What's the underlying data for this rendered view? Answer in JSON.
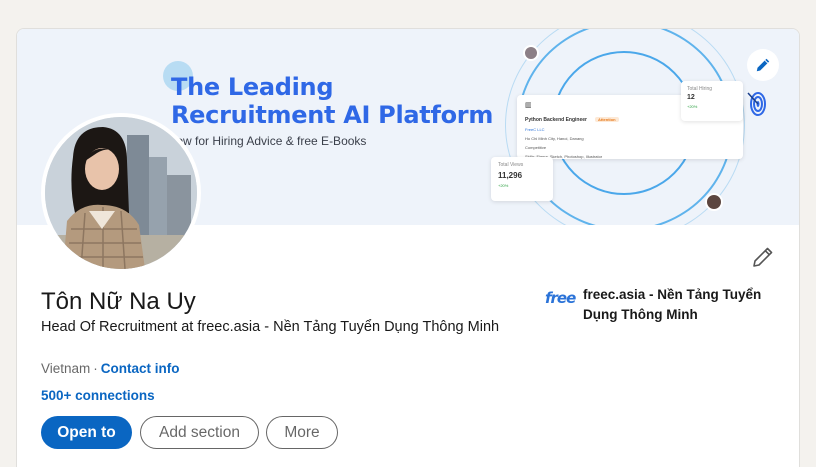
{
  "banner": {
    "headline_line1": "The Leading",
    "headline_line2": "Recruitment AI Platform",
    "subtitle": "llow for Hiring Advice & free E-Books",
    "job_card": {
      "title": "Python Backend Engineer",
      "tag": "Attention",
      "company": "FreeC LLC",
      "location": "Ho Chi Minh City, Hanoi, Danang",
      "salary": "Competitive",
      "skills": "Skills: Figma, Sketch, Photoshop, Illustrator"
    },
    "hiring_card": {
      "label": "Total Hiring",
      "value": "12",
      "change": "+20%"
    },
    "views_card": {
      "label": "Total Views",
      "value": "11,296",
      "change": "+20%"
    },
    "edit_icon": "pencil-icon",
    "accent_color": "#2f68e6"
  },
  "profile": {
    "name": "Tôn Nữ Na Uy",
    "headline": "Head Of Recruitment at freec.asia - Nền Tảng Tuyển Dụng Thông Minh",
    "location": "Vietnam",
    "separator": "·",
    "contact_info": "Contact info",
    "connections": "500+ connections"
  },
  "company": {
    "logo_text": "free",
    "name": "freec.asia - Nền Tảng Tuyển Dụng Thông Minh"
  },
  "actions": {
    "open_to": "Open to",
    "add_section": "Add section",
    "more": "More"
  },
  "colors": {
    "brand_blue": "#0a66c2",
    "background": "#f4f2ee"
  }
}
